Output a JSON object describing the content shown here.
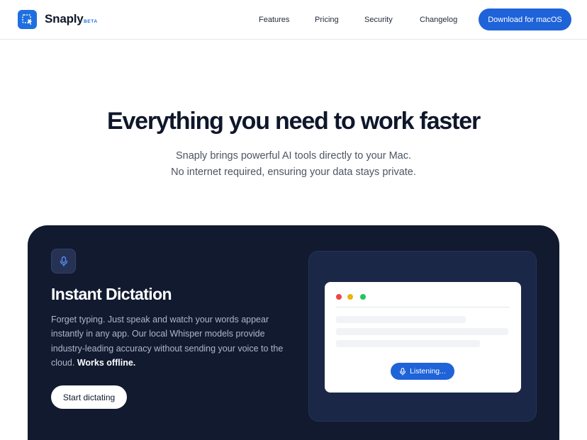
{
  "nav": {
    "brand": "Snaply",
    "badge": "BETA",
    "links": [
      "Features",
      "Pricing",
      "Security",
      "Changelog"
    ],
    "cta": "Download for macOS"
  },
  "hero": {
    "title": "Everything you need to work faster",
    "subtitle_line1": "Snaply brings powerful AI tools directly to your Mac.",
    "subtitle_line2": "No internet required, ensuring your data stays private."
  },
  "feature": {
    "icon": "microphone-icon",
    "title": "Instant Dictation",
    "body": "Forget typing. Just speak and watch your words appear instantly in any app. Our local Whisper models provide industry-leading accuracy without sending your voice to the cloud.",
    "body_emphasis": "Works offline.",
    "button": "Start dictating"
  },
  "mockup": {
    "status": "Listening...",
    "window_dot_colors": [
      "#ef4444",
      "#eab308",
      "#22c55e"
    ]
  },
  "colors": {
    "accent": "#1e63d8",
    "card_bg": "#121a30",
    "text": "#0f172a"
  }
}
